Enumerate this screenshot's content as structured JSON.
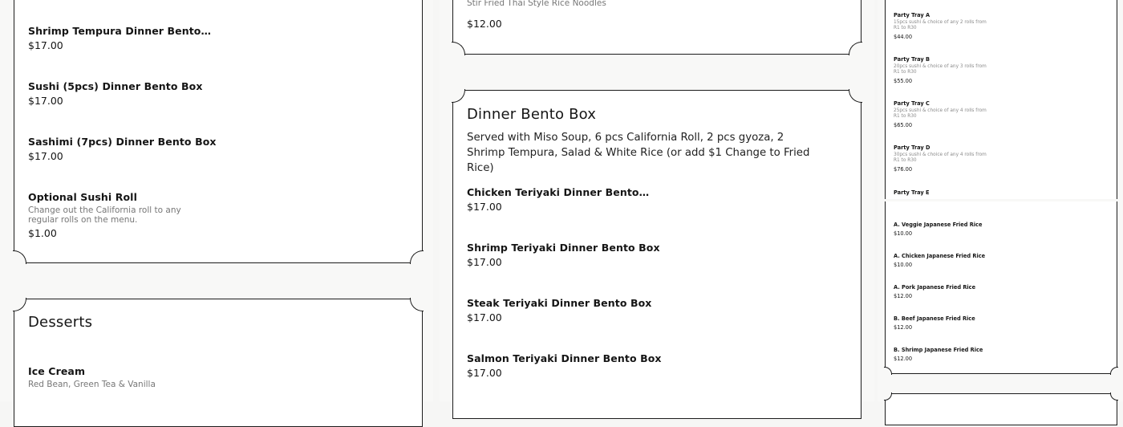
{
  "col1": {
    "items_top": [
      {
        "name": "Shrimp Tempura Dinner Bento…",
        "price": "$17.00"
      },
      {
        "name": "Sushi (5pcs) Dinner Bento Box",
        "price": "$17.00"
      },
      {
        "name": "Sashimi (7pcs) Dinner Bento Box",
        "price": "$17.00"
      },
      {
        "name": "Optional Sushi Roll",
        "desc": "Change out the California roll to any regular rolls on the menu.",
        "price": "$1.00"
      }
    ],
    "desserts": {
      "title": "Desserts",
      "items": [
        {
          "name": "Ice Cream",
          "desc": "Red Bean, Green Tea & Vanilla"
        }
      ]
    }
  },
  "col2": {
    "top_item": {
      "desc": "Stir Fried Thai Style Rice Noodles",
      "price": "$12.00"
    },
    "dinner_bento": {
      "title": "Dinner Bento Box",
      "desc": "Served with Miso Soup, 6 pcs California Roll, 2 pcs gyoza, 2 Shrimp Tempura, Salad & White Rice (or add $1 Change to Fried Rice)",
      "items": [
        {
          "name": "Chicken Teriyaki Dinner Bento…",
          "price": "$17.00"
        },
        {
          "name": "Shrimp Teriyaki Dinner Bento Box",
          "price": "$17.00"
        },
        {
          "name": "Steak Teriyaki Dinner Bento Box",
          "price": "$17.00"
        },
        {
          "name": "Salmon Teriyaki Dinner Bento Box",
          "price": "$17.00"
        }
      ]
    }
  },
  "col3": {
    "party_trays": [
      {
        "name": "Party Tray A",
        "desc": "15pcs sushi & choice of any 2 rolls from R1 to R30",
        "price": "$44.00"
      },
      {
        "name": "Party Tray B",
        "desc": "20pcs sushi & choice of any 3 rolls from R1 to R30",
        "price": "$55.00"
      },
      {
        "name": "Party Tray C",
        "desc": "25pcs sushi & choice of any 4 rolls from R1 to R30",
        "price": "$65.00"
      },
      {
        "name": "Party Tray D",
        "desc": "30pcs sushi & choice of any 4 rolls from R1 to R30",
        "price": "$76.00"
      },
      {
        "name": "Party Tray E"
      }
    ],
    "fried_rice": [
      {
        "name": "A. Veggie Japanese Fried Rice",
        "price": "$10.00"
      },
      {
        "name": "A. Chicken Japanese Fried Rice",
        "price": "$10.00"
      },
      {
        "name": "A. Pork Japanese Fried Rice",
        "price": "$12.00"
      },
      {
        "name": "B. Beef Japanese Fried Rice",
        "price": "$12.00"
      },
      {
        "name": "B. Shrimp Japanese Fried Rice",
        "price": "$12.00"
      }
    ]
  }
}
